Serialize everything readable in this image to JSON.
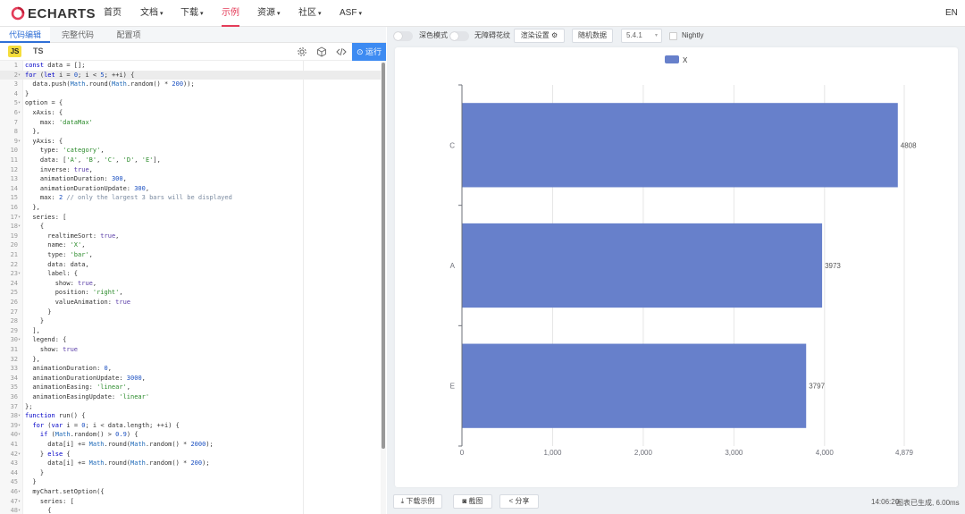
{
  "nav": {
    "logo": "ECHARTS",
    "items": [
      {
        "label": "首页",
        "caret": ""
      },
      {
        "label": "文档",
        "caret": "▾"
      },
      {
        "label": "下载",
        "caret": "▾"
      },
      {
        "label": "示例",
        "caret": ""
      },
      {
        "label": "资源",
        "caret": "▾"
      },
      {
        "label": "社区",
        "caret": "▾"
      },
      {
        "label": "ASF",
        "caret": "▾"
      }
    ],
    "active_index": 3,
    "lang": "EN",
    "accent_color": "#e43c59"
  },
  "editor": {
    "tabs": [
      "代码编辑",
      "完整代码",
      "配置项"
    ],
    "active_tab": 0,
    "lang_js": "JS",
    "lang_ts": "TS",
    "tool_icons": [
      "gear-icon",
      "cube-icon",
      "code-icon"
    ],
    "run_label": "运行",
    "run_icon": "play-circle-icon",
    "current_line": 2,
    "lines": [
      {
        "n": "1",
        "fold": "",
        "html": "<span class=\"kw\">const</span> data = [];"
      },
      {
        "n": "2",
        "fold": "▾",
        "html": "<span class=\"kw\">for</span> (<span class=\"kw\">let</span> i = <span class=\"num\">0</span>; i &lt; <span class=\"num\">5</span>; ++i) {"
      },
      {
        "n": "3",
        "fold": "",
        "html": "  data.push(<span class=\"fn\">Math</span>.round(<span class=\"fn\">Math</span>.random() * <span class=\"num\">200</span>));"
      },
      {
        "n": "4",
        "fold": "",
        "html": "}"
      },
      {
        "n": "5",
        "fold": "▾",
        "html": "option = {"
      },
      {
        "n": "6",
        "fold": "▾",
        "html": "  xAxis: {"
      },
      {
        "n": "7",
        "fold": "",
        "html": "    max: <span class=\"str\">'dataMax'</span>"
      },
      {
        "n": "8",
        "fold": "",
        "html": "  },"
      },
      {
        "n": "9",
        "fold": "▾",
        "html": "  yAxis: {"
      },
      {
        "n": "10",
        "fold": "",
        "html": "    type: <span class=\"str\">'category'</span>,"
      },
      {
        "n": "11",
        "fold": "",
        "html": "    data: [<span class=\"str\">'A'</span>, <span class=\"str\">'B'</span>, <span class=\"str\">'C'</span>, <span class=\"str\">'D'</span>, <span class=\"str\">'E'</span>],"
      },
      {
        "n": "12",
        "fold": "",
        "html": "    inverse: <span class=\"bool\">true</span>,"
      },
      {
        "n": "13",
        "fold": "",
        "html": "    animationDuration: <span class=\"num\">300</span>,"
      },
      {
        "n": "14",
        "fold": "",
        "html": "    animationDurationUpdate: <span class=\"num\">300</span>,"
      },
      {
        "n": "15",
        "fold": "",
        "html": "    max: <span class=\"num\">2</span> <span class=\"cmt\">// only the largest 3 bars will be displayed</span>"
      },
      {
        "n": "16",
        "fold": "",
        "html": "  },"
      },
      {
        "n": "17",
        "fold": "▾",
        "html": "  series: ["
      },
      {
        "n": "18",
        "fold": "▾",
        "html": "    {"
      },
      {
        "n": "19",
        "fold": "",
        "html": "      realtimeSort: <span class=\"bool\">true</span>,"
      },
      {
        "n": "20",
        "fold": "",
        "html": "      name: <span class=\"str\">'X'</span>,"
      },
      {
        "n": "21",
        "fold": "",
        "html": "      type: <span class=\"str\">'bar'</span>,"
      },
      {
        "n": "22",
        "fold": "",
        "html": "      data: data,"
      },
      {
        "n": "23",
        "fold": "▾",
        "html": "      label: {"
      },
      {
        "n": "24",
        "fold": "",
        "html": "        show: <span class=\"bool\">true</span>,"
      },
      {
        "n": "25",
        "fold": "",
        "html": "        position: <span class=\"str\">'right'</span>,"
      },
      {
        "n": "26",
        "fold": "",
        "html": "        valueAnimation: <span class=\"bool\">true</span>"
      },
      {
        "n": "27",
        "fold": "",
        "html": "      }"
      },
      {
        "n": "28",
        "fold": "",
        "html": "    }"
      },
      {
        "n": "29",
        "fold": "",
        "html": "  ],"
      },
      {
        "n": "30",
        "fold": "▾",
        "html": "  legend: {"
      },
      {
        "n": "31",
        "fold": "",
        "html": "    show: <span class=\"bool\">true</span>"
      },
      {
        "n": "32",
        "fold": "",
        "html": "  },"
      },
      {
        "n": "33",
        "fold": "",
        "html": "  animationDuration: <span class=\"num\">0</span>,"
      },
      {
        "n": "34",
        "fold": "",
        "html": "  animationDurationUpdate: <span class=\"num\">3000</span>,"
      },
      {
        "n": "35",
        "fold": "",
        "html": "  animationEasing: <span class=\"str\">'linear'</span>,"
      },
      {
        "n": "36",
        "fold": "",
        "html": "  animationEasingUpdate: <span class=\"str\">'linear'</span>"
      },
      {
        "n": "37",
        "fold": "",
        "html": "};"
      },
      {
        "n": "38",
        "fold": "▾",
        "html": "<span class=\"kw\">function</span> run() {"
      },
      {
        "n": "39",
        "fold": "▾",
        "html": "  <span class=\"kw\">for</span> (<span class=\"kw\">var</span> i = <span class=\"num\">0</span>; i &lt; data.length; ++i) {"
      },
      {
        "n": "40",
        "fold": "▾",
        "html": "    <span class=\"kw\">if</span> (<span class=\"fn\">Math</span>.random() &gt; <span class=\"num\">0.9</span>) {"
      },
      {
        "n": "41",
        "fold": "",
        "html": "      data[i] += <span class=\"fn\">Math</span>.round(<span class=\"fn\">Math</span>.random() * <span class=\"num\">2000</span>);"
      },
      {
        "n": "42",
        "fold": "▾",
        "html": "    } <span class=\"kw\">else</span> {"
      },
      {
        "n": "43",
        "fold": "",
        "html": "      data[i] += <span class=\"fn\">Math</span>.round(<span class=\"fn\">Math</span>.random() * <span class=\"num\">200</span>);"
      },
      {
        "n": "44",
        "fold": "",
        "html": "    }"
      },
      {
        "n": "45",
        "fold": "",
        "html": "  }"
      },
      {
        "n": "46",
        "fold": "▾",
        "html": "  myChart.setOption({"
      },
      {
        "n": "47",
        "fold": "▾",
        "html": "    series: ["
      },
      {
        "n": "48",
        "fold": "▾",
        "html": "      {"
      }
    ]
  },
  "controls": {
    "dark_mode_label": "深色模式",
    "accessibility_label": "无障碍花纹",
    "render_settings_label": "渲染设置",
    "render_settings_icon": "gear-icon",
    "random_data_label": "随机数据",
    "version": "5.4.1",
    "nightly_label": "Nightly"
  },
  "bottom": {
    "download_label": "下载示例",
    "download_icon": "download-icon",
    "screenshot_label": "截图",
    "screenshot_icon": "camera-icon",
    "share_label": "分享",
    "share_icon": "share-icon",
    "time": "14:06:20",
    "status": "图表已生成, 6.00ms"
  },
  "chart_data": {
    "type": "bar",
    "orientation": "horizontal",
    "legend": [
      "X"
    ],
    "legend_position": "top-center",
    "categories": [
      "C",
      "A",
      "E"
    ],
    "values": [
      4808,
      3973,
      3797
    ],
    "bar_color": "#6780cb",
    "xlim": [
      0,
      4879
    ],
    "x_ticks": [
      0,
      1000,
      2000,
      3000,
      4000,
      4879
    ],
    "x_tick_labels": [
      "0",
      "1,000",
      "2,000",
      "3,000",
      "4,000",
      "4,879"
    ],
    "grid": "vertical",
    "labels_position": "right"
  }
}
